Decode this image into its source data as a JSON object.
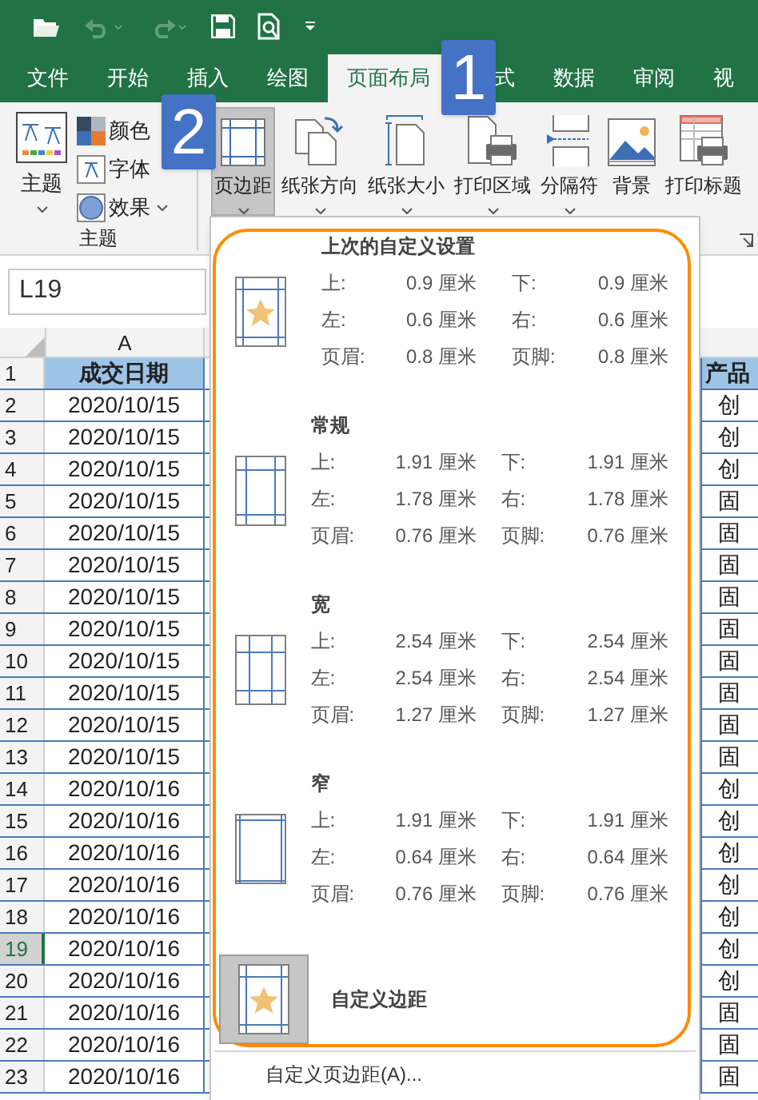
{
  "tabs": [
    {
      "label": "文件",
      "selected": false
    },
    {
      "label": "开始",
      "selected": false
    },
    {
      "label": "插入",
      "selected": false
    },
    {
      "label": "绘图",
      "selected": false
    },
    {
      "label": "页面布局",
      "selected": true
    },
    {
      "label": "式",
      "selected": false
    },
    {
      "label": "数据",
      "selected": false
    },
    {
      "label": "审阅",
      "selected": false
    },
    {
      "label": "视",
      "selected": false
    }
  ],
  "theme_group": {
    "label": "主题",
    "theme_button": "主题",
    "options": [
      {
        "kind": "colors",
        "label": "颜色"
      },
      {
        "kind": "fonts",
        "label": "字体"
      },
      {
        "kind": "effects",
        "label": "效果"
      }
    ]
  },
  "page_setup_buttons": [
    {
      "kind": "margins",
      "label": "页边距",
      "selected": true,
      "dropdown": true
    },
    {
      "kind": "orientation",
      "label": "纸张方向",
      "selected": false,
      "dropdown": true
    },
    {
      "kind": "size",
      "label": "纸张大小",
      "selected": false,
      "dropdown": true
    },
    {
      "kind": "print_area",
      "label": "打印区域",
      "selected": false,
      "dropdown": true
    },
    {
      "kind": "breaks",
      "label": "分隔符",
      "selected": false,
      "dropdown": true
    },
    {
      "kind": "background",
      "label": "背景",
      "selected": false,
      "dropdown": false
    },
    {
      "kind": "print_titles",
      "label": "打印标题",
      "selected": false,
      "dropdown": false
    }
  ],
  "name_box": "L19",
  "sheet": {
    "column": "A",
    "header": {
      "number": "1",
      "a": "成交日期",
      "right": "产品"
    },
    "rows": [
      {
        "number": "2",
        "a": "2020/10/15",
        "right": "创",
        "selected": false
      },
      {
        "number": "3",
        "a": "2020/10/15",
        "right": "创",
        "selected": false
      },
      {
        "number": "4",
        "a": "2020/10/15",
        "right": "创",
        "selected": false
      },
      {
        "number": "5",
        "a": "2020/10/15",
        "right": "固",
        "selected": false
      },
      {
        "number": "6",
        "a": "2020/10/15",
        "right": "固",
        "selected": false
      },
      {
        "number": "7",
        "a": "2020/10/15",
        "right": "固",
        "selected": false
      },
      {
        "number": "8",
        "a": "2020/10/15",
        "right": "固",
        "selected": false
      },
      {
        "number": "9",
        "a": "2020/10/15",
        "right": "固",
        "selected": false
      },
      {
        "number": "10",
        "a": "2020/10/15",
        "right": "固",
        "selected": false
      },
      {
        "number": "11",
        "a": "2020/10/15",
        "right": "固",
        "selected": false
      },
      {
        "number": "12",
        "a": "2020/10/15",
        "right": "固",
        "selected": false
      },
      {
        "number": "13",
        "a": "2020/10/15",
        "right": "固",
        "selected": false
      },
      {
        "number": "14",
        "a": "2020/10/16",
        "right": "创",
        "selected": false
      },
      {
        "number": "15",
        "a": "2020/10/16",
        "right": "创",
        "selected": false
      },
      {
        "number": "16",
        "a": "2020/10/16",
        "right": "创",
        "selected": false
      },
      {
        "number": "17",
        "a": "2020/10/16",
        "right": "创",
        "selected": false
      },
      {
        "number": "18",
        "a": "2020/10/16",
        "right": "创",
        "selected": false
      },
      {
        "number": "19",
        "a": "2020/10/16",
        "right": "创",
        "selected": true
      },
      {
        "number": "20",
        "a": "2020/10/16",
        "right": "创",
        "selected": false
      },
      {
        "number": "21",
        "a": "2020/10/16",
        "right": "固",
        "selected": false
      },
      {
        "number": "22",
        "a": "2020/10/16",
        "right": "固",
        "selected": false
      },
      {
        "number": "23",
        "a": "2020/10/16",
        "right": "固",
        "selected": false
      }
    ]
  },
  "margins_menu": {
    "items": [
      {
        "kind": "recent",
        "title": "上次的自定义设置",
        "selected": false,
        "values": [
          [
            "上:",
            "0.9 厘米",
            "下:",
            "0.9 厘米"
          ],
          [
            "左:",
            "0.6 厘米",
            "右:",
            "0.6 厘米"
          ],
          [
            "页眉:",
            "0.8 厘米",
            "页脚:",
            "0.8 厘米"
          ]
        ]
      },
      {
        "kind": "normal",
        "title": "常规",
        "selected": false,
        "values": [
          [
            "上:",
            "1.91 厘米",
            "下:",
            "1.91 厘米"
          ],
          [
            "左:",
            "1.78 厘米",
            "右:",
            "1.78 厘米"
          ],
          [
            "页眉:",
            "0.76 厘米",
            "页脚:",
            "0.76 厘米"
          ]
        ]
      },
      {
        "kind": "wide",
        "title": "宽",
        "selected": false,
        "values": [
          [
            "上:",
            "2.54 厘米",
            "下:",
            "2.54 厘米"
          ],
          [
            "左:",
            "2.54 厘米",
            "右:",
            "2.54 厘米"
          ],
          [
            "页眉:",
            "1.27 厘米",
            "页脚:",
            "1.27 厘米"
          ]
        ]
      },
      {
        "kind": "narrow",
        "title": "窄",
        "selected": false,
        "values": [
          [
            "上:",
            "1.91 厘米",
            "下:",
            "1.91 厘米"
          ],
          [
            "左:",
            "0.64 厘米",
            "右:",
            "0.64 厘米"
          ],
          [
            "页眉:",
            "0.76 厘米",
            "页脚:",
            "0.76 厘米"
          ]
        ]
      },
      {
        "kind": "custom",
        "title": "自定义边距",
        "selected": true
      }
    ],
    "footer": "自定义页边距(A)..."
  },
  "callouts": [
    {
      "kind": "tab",
      "label": "1"
    },
    {
      "kind": "button",
      "label": "2"
    }
  ]
}
